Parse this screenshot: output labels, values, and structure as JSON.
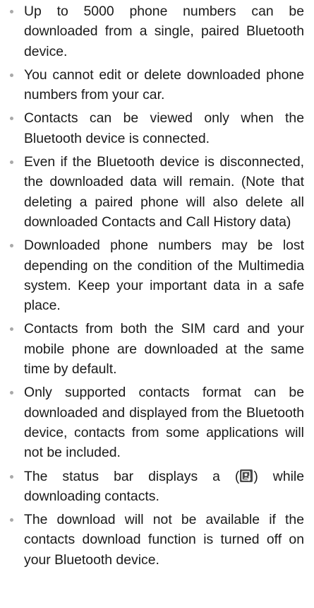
{
  "notes": [
    "Up to 5000 phone numbers can be downloaded from a single, paired Bluetooth device.",
    "You cannot edit or delete downloaded phone numbers from your car.",
    "Contacts can be viewed only when the Bluetooth device is connected.",
    "Even if the Bluetooth device is disconnected, the downloaded data will remain. (Note that deleting a paired phone will also delete all downloaded Contacts and Call History data)",
    "Downloaded phone numbers may be lost depending on the condition of the Multimedia system. Keep your important data in a safe place.",
    "Contacts from both the SIM card and your mobile phone are downloaded at the same time by default.",
    "Only supported contacts format can be downloaded and displayed from the Bluetooth device, contacts from some applications will not be included.",
    "The download will not be available if the contacts download function is turned off on your Bluetooth device."
  ],
  "status_note": {
    "before": "The status bar displays a (",
    "icon": "contacts-download-icon",
    "after": ") while downloading contacts."
  }
}
